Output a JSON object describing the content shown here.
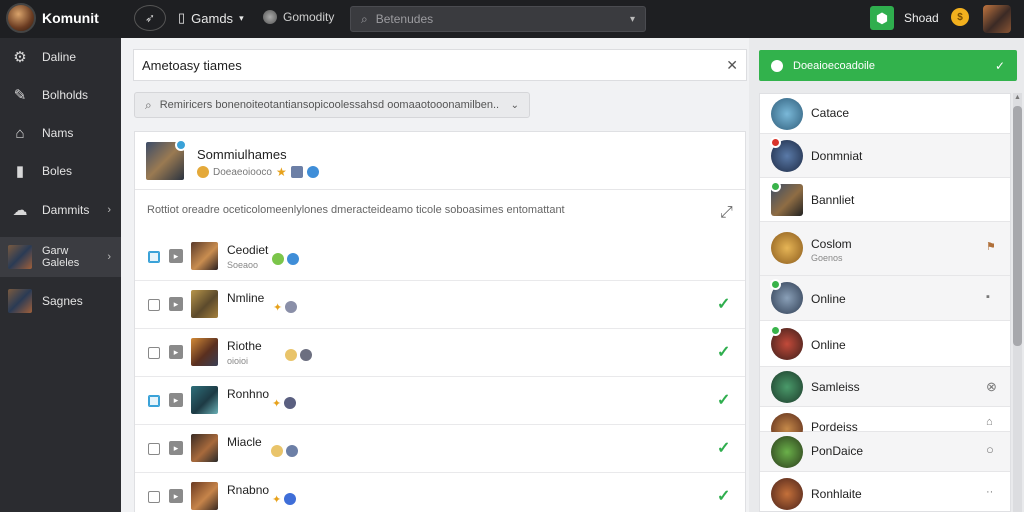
{
  "app": {
    "logo_text": "Komunit",
    "logo_sub": "●"
  },
  "topbar": {
    "back_icon": "rocket-icon",
    "games_label": "Gamds",
    "community_label": "Gomodity",
    "search_placeholder": "Betenudes",
    "user_name": "Shoad",
    "coin_label": "$"
  },
  "sidebar": {
    "items": [
      {
        "label": "Daline",
        "icon": "gear-icon"
      },
      {
        "label": "Bolholds",
        "icon": "pencil-icon"
      },
      {
        "label": "Nams",
        "icon": "home-icon"
      },
      {
        "label": "Boles",
        "icon": "bookmark-icon"
      },
      {
        "label": "Dammits",
        "icon": "chat-icon"
      },
      {
        "label": "Garw Galeles",
        "icon": "thumbnail"
      },
      {
        "label": "Sagnes",
        "icon": "thumbnail"
      }
    ]
  },
  "main": {
    "title_value": "Ametoasy tiames",
    "filter_placeholder": "Remiricers bonenoiteotantiansopicoolessahsd oomaaotooonamilben..",
    "card": {
      "title": "Sommiulhames",
      "sub": "Doeaeoiooco",
      "description": "Rottiot oreadre oceticolomeenlylones dmeracteideamo ticole soboasimes entomattant",
      "rows": [
        {
          "name": "Ceodiet",
          "meta": "Soeaoo",
          "checked": true,
          "ok": false
        },
        {
          "name": "Nmline",
          "meta": "",
          "checked": false,
          "ok": true
        },
        {
          "name": "Riothe",
          "meta": "oioioi",
          "checked": false,
          "ok": true
        },
        {
          "name": "Ronhno",
          "meta": "",
          "checked": true,
          "ok": true
        },
        {
          "name": "Miacle",
          "meta": "",
          "checked": false,
          "ok": true
        },
        {
          "name": "Rnabno",
          "meta": "",
          "checked": false,
          "ok": true
        }
      ]
    }
  },
  "right": {
    "button_label": "Doeaioecoadoile",
    "friends": [
      {
        "name": "Catace",
        "sub": "",
        "action": ""
      },
      {
        "name": "Donmniat",
        "sub": "",
        "action": ""
      },
      {
        "name": "Bannliet",
        "sub": "",
        "action": ""
      },
      {
        "name": "Coslom",
        "sub": "Goenos",
        "action": "⚑"
      },
      {
        "name": "Online",
        "sub": "",
        "action": "▪"
      },
      {
        "name": "Online",
        "sub": "",
        "action": ""
      },
      {
        "name": "Samleiss",
        "sub": "",
        "action": "⊗"
      },
      {
        "name": "Pordeiss",
        "sub": "",
        "action": "⌂"
      },
      {
        "name": "PonDaice",
        "sub": "",
        "action": "○"
      },
      {
        "name": "Ronhlaite",
        "sub": "",
        "action": "··"
      }
    ]
  },
  "colors": {
    "accent_green": "#32b24c",
    "sidebar_bg": "#2b2c30",
    "topbar_bg": "#1e1f22"
  }
}
